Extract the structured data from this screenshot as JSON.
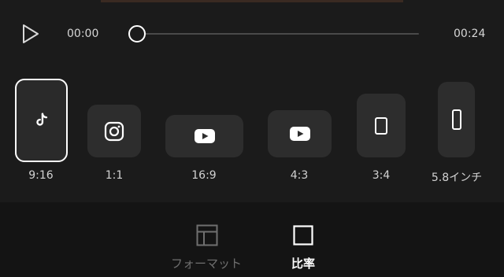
{
  "player": {
    "current_time": "00:00",
    "total_time": "00:24",
    "progress": 0
  },
  "ratios": [
    {
      "label": "9:16",
      "icon": "tiktok-icon",
      "selected": true
    },
    {
      "label": "1:1",
      "icon": "instagram-icon",
      "selected": false
    },
    {
      "label": "16:9",
      "icon": "youtube-icon",
      "selected": false
    },
    {
      "label": "4:3",
      "icon": "youtube-icon",
      "selected": false
    },
    {
      "label": "3:4",
      "icon": "portrait-phone-icon",
      "selected": false
    },
    {
      "label": "5.8インチ",
      "icon": "tall-phone-icon",
      "selected": false
    }
  ],
  "tabs": [
    {
      "label": "フォーマット",
      "icon": "layout-icon",
      "active": false
    },
    {
      "label": "比率",
      "icon": "square-icon",
      "active": true
    }
  ],
  "colors": {
    "background": "#1b1b1b",
    "tile": "#2d2d2d",
    "selected_border": "#ffffff",
    "tabbar": "#141414",
    "inactive_tab": "#6f6f6f"
  }
}
